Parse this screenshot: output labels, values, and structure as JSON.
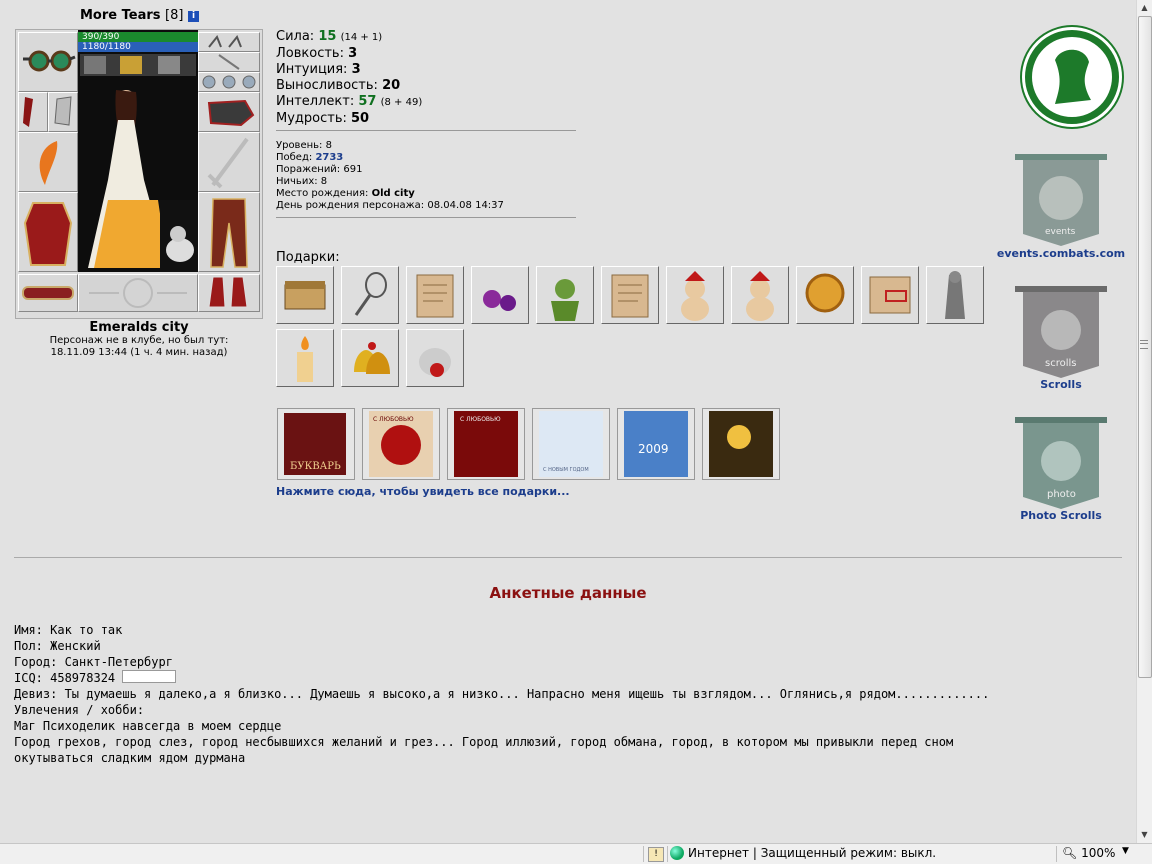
{
  "character": {
    "name": "More Tears",
    "level": "[8]",
    "info_icon": "i",
    "hp": "390/390",
    "mana": "1180/1180",
    "city": "Emeralds city",
    "status_line1": "Персонаж не в клубе, но был тут:",
    "status_line2": "18.11.09 13:44 (1 ч. 4 мин. назад)"
  },
  "stats": {
    "strength": {
      "label": "Сила:",
      "value": "15",
      "extra": "(14 + 1)"
    },
    "agility": {
      "label": "Ловкость:",
      "value": "3"
    },
    "intuition": {
      "label": "Интуиция:",
      "value": "3"
    },
    "endurance": {
      "label": "Выносливость:",
      "value": "20"
    },
    "intellect": {
      "label": "Интеллект:",
      "value": "57",
      "extra": "(8 + 49)"
    },
    "wisdom": {
      "label": "Мудрость:",
      "value": "50"
    }
  },
  "info": {
    "level_label": "Уровень:",
    "level_value": "8",
    "wins_label": "Побед:",
    "wins_value": "2733",
    "losses_label": "Поражений:",
    "losses_value": "691",
    "draws_label": "Ничьих:",
    "draws_value": "8",
    "birthplace_label": "Место рождения:",
    "birthplace_value": "Old city",
    "birthday_label": "День рождения персонажа:",
    "birthday_value": "08.04.08 14:37"
  },
  "gifts": {
    "title": "Подарки:",
    "items": [
      "chest",
      "mirror",
      "scroll",
      "potions",
      "goblin",
      "scroll",
      "teddy-bear",
      "teddy-bear",
      "coin",
      "scroll-stamped",
      "statue",
      "candle",
      "bells",
      "mouse"
    ],
    "cards": [
      "БУКВАРЬ",
      "С ЛЮБОВЬЮ",
      "С ЛЮБОВЬЮ",
      "С НОВЫМ ГОДОМ",
      "2009",
      "fireworks"
    ],
    "see_all": "Нажмите сюда, чтобы увидеть все подарки..."
  },
  "side_links": {
    "events_banner": "events",
    "events": "events.combats.com",
    "scrolls_banner": "scrolls",
    "scrolls": "Scrolls",
    "photo_banner": "photo",
    "photo": "Photo Scrolls"
  },
  "anketa": {
    "title": "Анкетные данные",
    "name": "Имя: Как то так",
    "gender": "Пол: Женский",
    "city": "Город: Санкт-Петербург",
    "icq": "ICQ: 458978324",
    "motto": "Девиз: Ты думаешь я далеко,а я близко... Думаешь я высоко,а я низко... Напрасно меня ищешь ты взглядом... Оглянись,я рядом.............",
    "hobby_label": "Увлечения / хобби:",
    "hobby1": "Маг Психоделик навсегда в моем сердце",
    "hobby2": "Город грехов, город слез, город несбывшихся желаний и грез... Город иллюзий, город обмана, город, в котором мы привыкли перед сном",
    "hobby3": "окутываться сладким ядом дурмана"
  },
  "statusbar": {
    "zone": "Интернет | Защищенный режим: выкл.",
    "zoom": "100%"
  },
  "colors": {
    "accent": "#1c3d8c",
    "title_red": "#8b1111",
    "stat_green": "#107020",
    "emblem_green": "#1d7a2a"
  }
}
